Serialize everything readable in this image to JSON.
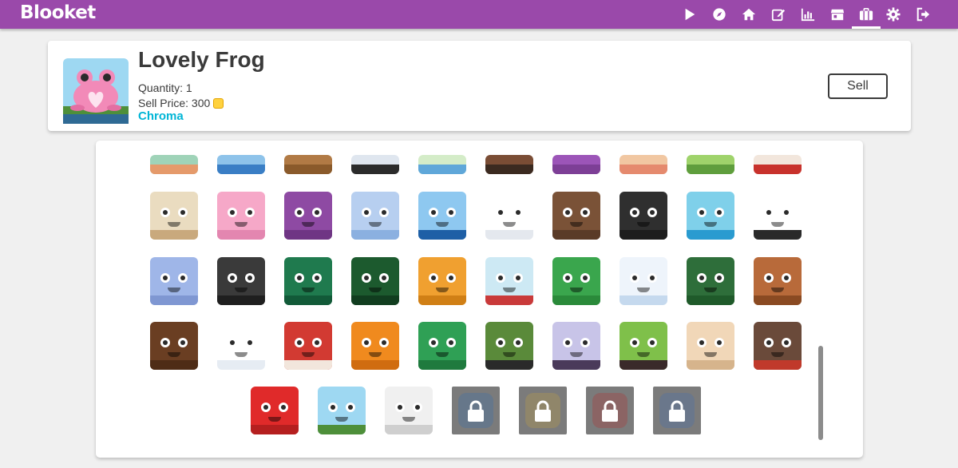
{
  "app": {
    "logo": "Blooket"
  },
  "nav": [
    {
      "name": "play-icon"
    },
    {
      "name": "compass-icon"
    },
    {
      "name": "home-icon"
    },
    {
      "name": "edit-icon"
    },
    {
      "name": "stats-icon"
    },
    {
      "name": "market-icon"
    },
    {
      "name": "blooks-icon",
      "active": true
    },
    {
      "name": "settings-icon"
    },
    {
      "name": "logout-icon"
    }
  ],
  "selected": {
    "name": "Lovely Frog",
    "quantity": "Quantity: 1",
    "sell_price": "Sell Price: 300",
    "rarity": "Chroma",
    "sell_label": "Sell"
  },
  "colors": {
    "topbar": "#9a49aa",
    "rarity": "#00b5d6"
  },
  "blooks": {
    "row0": [
      {
        "icon": "blook-partial",
        "color": "#9fd3b8",
        "base": "#e59a6b"
      },
      {
        "icon": "blook-partial",
        "color": "#8ec3ea",
        "base": "#3a7ec5"
      },
      {
        "icon": "blook-partial",
        "color": "#b17a45",
        "base": "#8a5a2b"
      },
      {
        "icon": "blook-partial",
        "color": "#dfe6ef",
        "base": "#2b2b2b"
      },
      {
        "icon": "blook-partial",
        "color": "#d4ecc8",
        "base": "#5fa7d9"
      },
      {
        "icon": "blook-partial",
        "color": "#7a4d35",
        "base": "#3b2a20"
      },
      {
        "icon": "blook-partial",
        "color": "#9c55b8",
        "base": "#7d3f96"
      },
      {
        "icon": "blook-partial",
        "color": "#f1c7a2",
        "base": "#e58a6e"
      },
      {
        "icon": "blook-partial",
        "color": "#9fd36b",
        "base": "#5f9e3d"
      },
      {
        "icon": "blook-partial",
        "color": "#f2e6dc",
        "base": "#c8322c"
      }
    ],
    "row1": [
      {
        "icon": "hedgehog-icon",
        "color": "#eadcc0",
        "base": "#c9a97d"
      },
      {
        "icon": "blobfish-icon",
        "color": "#f6a8c8",
        "base": "#e386b0"
      },
      {
        "icon": "octopus-icon",
        "color": "#8e4aa3",
        "base": "#6f3584"
      },
      {
        "icon": "narwhal-icon",
        "color": "#b7cff0",
        "base": "#8bb0e0"
      },
      {
        "icon": "shark-icon",
        "color": "#8ec8f0",
        "base": "#1e5fa6"
      },
      {
        "icon": "panda-icon",
        "color": "#ffffff",
        "base": "#e4e8ee"
      },
      {
        "icon": "sloth-icon",
        "color": "#7a5237",
        "base": "#5a3b27"
      },
      {
        "icon": "cockatoo-icon",
        "color": "#2f2f2f",
        "base": "#1d1d1d"
      },
      {
        "icon": "flamingo-icon",
        "color": "#7fd0ea",
        "base": "#2a9bd0"
      },
      {
        "icon": "zebra-icon",
        "color": "#ffffff",
        "base": "#2a2a2a"
      }
    ],
    "row2": [
      {
        "icon": "elephant-icon",
        "color": "#9fb6e8",
        "base": "#7f97d2"
      },
      {
        "icon": "lemur-icon",
        "color": "#3a3a3a",
        "base": "#1f1f1f"
      },
      {
        "icon": "peacock-icon",
        "color": "#1f7a4e",
        "base": "#125a38"
      },
      {
        "icon": "chameleon-icon",
        "color": "#1c5a2e",
        "base": "#113d1f"
      },
      {
        "icon": "lion-icon",
        "color": "#f0a030",
        "base": "#d07f15"
      },
      {
        "icon": "snow-globe-icon",
        "color": "#cde9f4",
        "base": "#c93a3a"
      },
      {
        "icon": "gift-icon",
        "color": "#3aa64d",
        "base": "#2a8a3a"
      },
      {
        "icon": "hot-chocolate-icon",
        "color": "#eef4fb",
        "base": "#c5d9ee"
      },
      {
        "icon": "wreath-icon",
        "color": "#2e6e3a",
        "base": "#1f5a2a"
      },
      {
        "icon": "gingerbread-icon",
        "color": "#b86a3a",
        "base": "#8a4a22"
      }
    ],
    "row3": [
      {
        "icon": "gingerbread-house-icon",
        "color": "#6a3e22",
        "base": "#4e2c16"
      },
      {
        "icon": "snowman-icon",
        "color": "#ffffff",
        "base": "#e6ecf3"
      },
      {
        "icon": "santa-icon",
        "color": "#d23a32",
        "base": "#f2e6dc"
      },
      {
        "icon": "pumpkin-icon",
        "color": "#f08a1e",
        "base": "#d06c10"
      },
      {
        "icon": "swamp-monster-icon",
        "color": "#2fa055",
        "base": "#1f7a3e"
      },
      {
        "icon": "frankenstein-icon",
        "color": "#5a8a3a",
        "base": "#2a2a2a"
      },
      {
        "icon": "vampire-icon",
        "color": "#c8c4e8",
        "base": "#4a3a5a"
      },
      {
        "icon": "zombie-icon",
        "color": "#7fc04a",
        "base": "#3a2a2a"
      },
      {
        "icon": "mummy-icon",
        "color": "#f1d7b8",
        "base": "#d6b48c"
      },
      {
        "icon": "werewolf-icon",
        "color": "#6a4a3a",
        "base": "#c0392b"
      }
    ],
    "row4": [
      {
        "icon": "tv-icon",
        "color": "#e02a2a",
        "base": "#b51f1f",
        "locked": false
      },
      {
        "icon": "lovely-frog-icon",
        "color": "#9ed8f2",
        "base": "#4e8f3a",
        "locked": false
      },
      {
        "icon": "ghost-mustache-icon",
        "color": "#f0f0f0",
        "base": "#cfcfcf",
        "locked": false
      },
      {
        "icon": "lock-icon",
        "color": "#3f6fa6",
        "locked": true
      },
      {
        "icon": "lock-icon",
        "color": "#b89a4a",
        "locked": true
      },
      {
        "icon": "lock-icon",
        "color": "#a83a3a",
        "locked": true
      },
      {
        "icon": "lock-icon",
        "color": "#4a6fa8",
        "locked": true
      }
    ]
  }
}
